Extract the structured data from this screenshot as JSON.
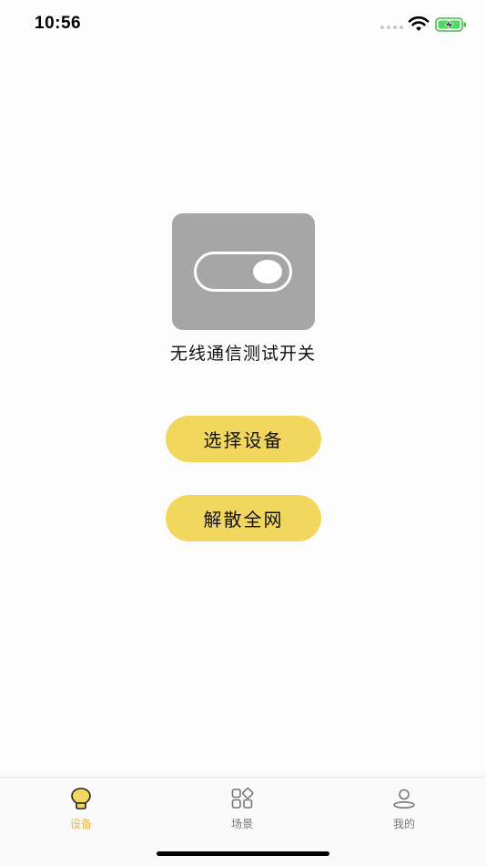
{
  "status_bar": {
    "time": "10:56"
  },
  "device": {
    "title": "无线通信测试开关",
    "icon": "toggle-switch-icon",
    "card_color": "#a6a6a6"
  },
  "actions": {
    "select_device_label": "选择设备",
    "dissolve_network_label": "解散全网",
    "button_color": "#f2d75f"
  },
  "tab_bar": {
    "active": "devices",
    "active_color": "#e8b93a",
    "items": [
      {
        "label": "设备",
        "icon": "bulb-icon"
      },
      {
        "label": "场景",
        "icon": "scenes-grid-icon"
      },
      {
        "label": "我的",
        "icon": "profile-icon"
      }
    ]
  }
}
